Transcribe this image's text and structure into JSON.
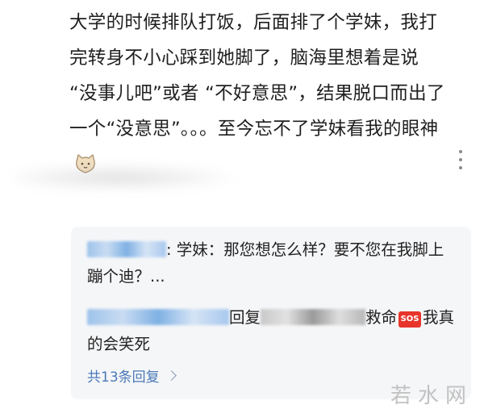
{
  "post": {
    "text": "大学的时候排队打饭，后面排了个学妹，我打完转身不小心踩到她脚了，脑海里想着是说 “没事儿吧”或者 “不好意思”，结果脱口而出了一个“没意思”。。。至今忘不了学妹看我的眼神",
    "emoji_icon": "cat-face-icon"
  },
  "more_icon": "more-vertical-icon",
  "replies": [
    {
      "author_masked": true,
      "separator": ":",
      "text": " 学妹：那您想怎么样？要不您在我脚上蹦个迪？..."
    },
    {
      "author_masked": true,
      "action": "回复",
      "text_before": "救命",
      "sos_label": "SOS",
      "text_after": "我真的会笑死"
    }
  ],
  "view_replies": "共13条回复",
  "watermark": "若水网",
  "colors": {
    "link": "#4a79b8",
    "reply_bg": "#f5f6f8",
    "sos": "#e8352b"
  }
}
